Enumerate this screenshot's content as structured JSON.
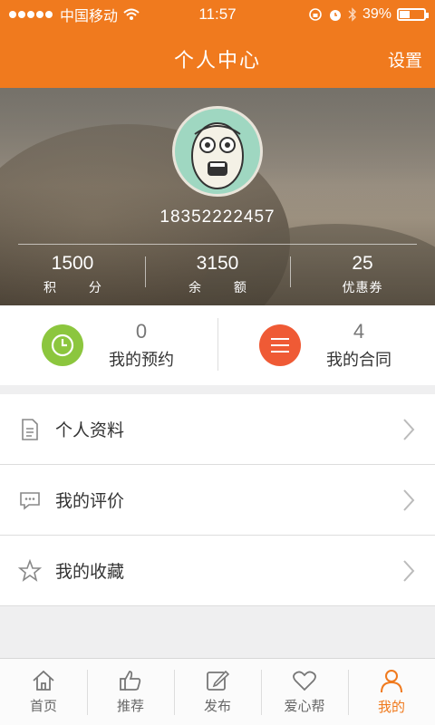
{
  "status_bar": {
    "carrier": "中国移动",
    "time": "11:57",
    "battery": "39%",
    "battery_level": 0.39
  },
  "header": {
    "title": "个人中心",
    "settings_label": "设置"
  },
  "profile": {
    "phone": "18352222457",
    "stats": [
      {
        "value": "1500",
        "label": "积 分"
      },
      {
        "value": "3150",
        "label": "余 额"
      },
      {
        "value": "25",
        "label": "优惠券"
      }
    ]
  },
  "quick": [
    {
      "count": "0",
      "label": "我的预约",
      "icon": "clock-icon",
      "color": "#8cc63e"
    },
    {
      "count": "4",
      "label": "我的合同",
      "icon": "list-icon",
      "color": "#ef5a35"
    }
  ],
  "menu": [
    {
      "label": "个人资料",
      "icon": "document-icon"
    },
    {
      "label": "我的评价",
      "icon": "comment-icon"
    },
    {
      "label": "我的收藏",
      "icon": "star-icon"
    }
  ],
  "tabs": [
    {
      "label": "首页",
      "icon": "home-icon"
    },
    {
      "label": "推荐",
      "icon": "thumbs-up-icon"
    },
    {
      "label": "发布",
      "icon": "edit-icon"
    },
    {
      "label": "爱心帮",
      "icon": "heart-icon"
    },
    {
      "label": "我的",
      "icon": "user-icon",
      "active": true
    }
  ],
  "colors": {
    "brand": "#f07a1e",
    "clock": "#8cc63e",
    "contract": "#ef5a35"
  }
}
